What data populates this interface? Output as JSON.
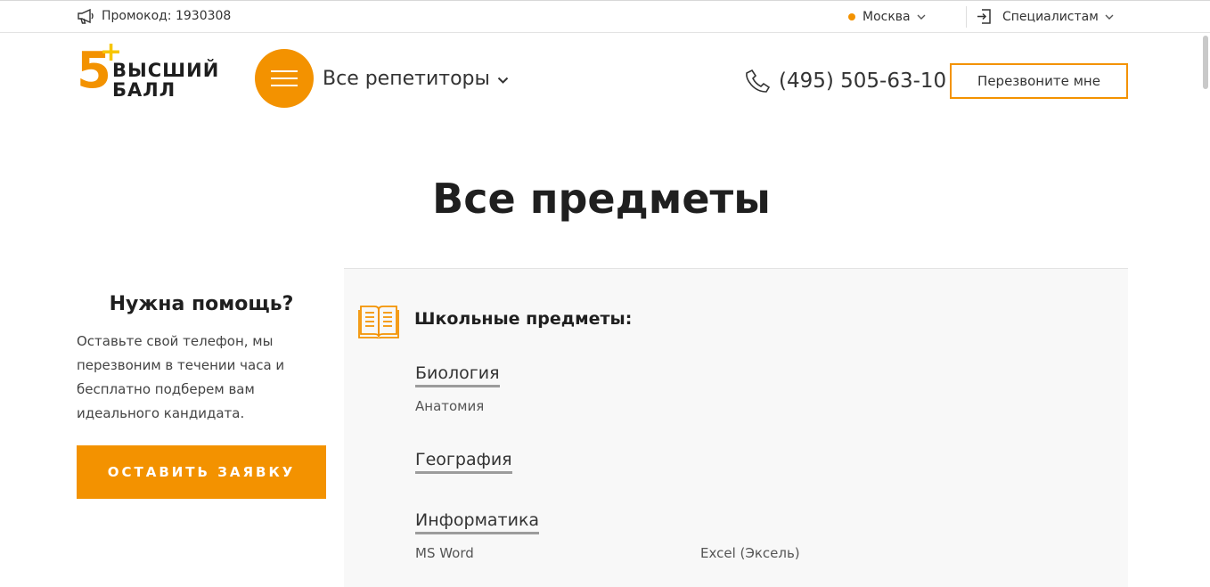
{
  "topbar": {
    "promo_text": "Промокод: 1930308",
    "city": "Москва",
    "specialists": "Специалистам"
  },
  "header": {
    "logo_number": "5",
    "logo_plus": "+",
    "logo_line1": "ВЫСШИЙ",
    "logo_line2": "БАЛЛ",
    "nav_label": "Все репетиторы",
    "phone": "(495) 505-63-10",
    "callback_label": "Перезвоните мне"
  },
  "page": {
    "title": "Все предметы"
  },
  "help": {
    "title": "Нужна помощь?",
    "text": "Оставьте свой телефон, мы перезвоним в течении часа и бесплатно подберем вам идеального кандидата.",
    "button": "ОСТАВИТЬ ЗАЯВКУ"
  },
  "subjects": {
    "section_title": "Школьные предметы:",
    "items": [
      {
        "name": "Биология",
        "subitems": [
          "Анатомия"
        ]
      },
      {
        "name": "География",
        "subitems": []
      },
      {
        "name": "Информатика",
        "subitems": [
          "MS Word",
          "Excel (Эксель)"
        ]
      }
    ]
  },
  "colors": {
    "accent": "#f39200",
    "accent_plus": "#f7c600",
    "panel_bg": "#f8f8f8"
  },
  "icons": [
    "megaphone-icon",
    "login-icon",
    "chevron-down-icon",
    "menu-icon",
    "phone-icon",
    "book-icon"
  ]
}
